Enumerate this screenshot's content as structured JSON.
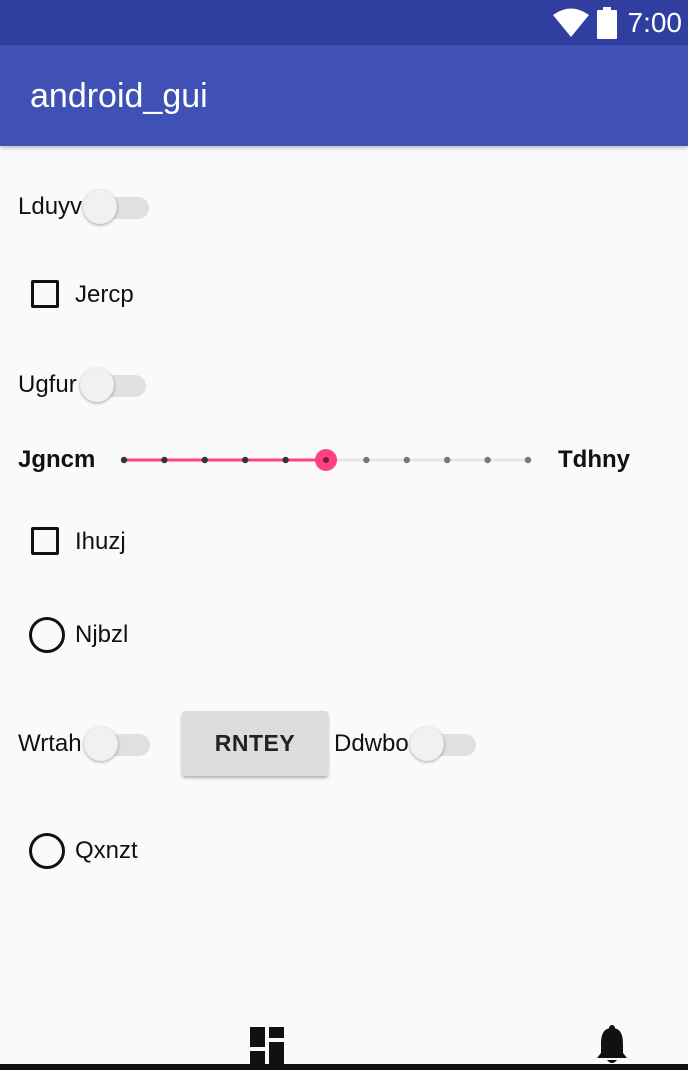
{
  "status_bar": {
    "time": "7:00",
    "icons": [
      "wifi-icon",
      "battery-icon"
    ]
  },
  "app_bar": {
    "title": "android_gui",
    "color": "#3f51b5"
  },
  "controls": {
    "switch1": {
      "label": "Lduyv",
      "checked": false
    },
    "checkbox1": {
      "label": "Jercp",
      "checked": false
    },
    "switch2": {
      "label": "Ugfur",
      "checked": false
    },
    "seekbar": {
      "left_label": "Jgncm",
      "right_label": "Tdhny",
      "max": 10,
      "value": 5,
      "accent": "#ff4081"
    },
    "checkbox2": {
      "label": "Ihuzj",
      "checked": false
    },
    "radio1": {
      "label": "Njbzl",
      "checked": false
    },
    "switch3": {
      "label": "Wrtah",
      "checked": false
    },
    "button": {
      "label": "RNTEY"
    },
    "switch4": {
      "label": "Ddwbo",
      "checked": false
    },
    "radio2": {
      "label": "Qxnzt",
      "checked": false
    }
  },
  "bottom_nav": {
    "icons": [
      "dashboard-icon",
      "notifications-icon"
    ]
  }
}
